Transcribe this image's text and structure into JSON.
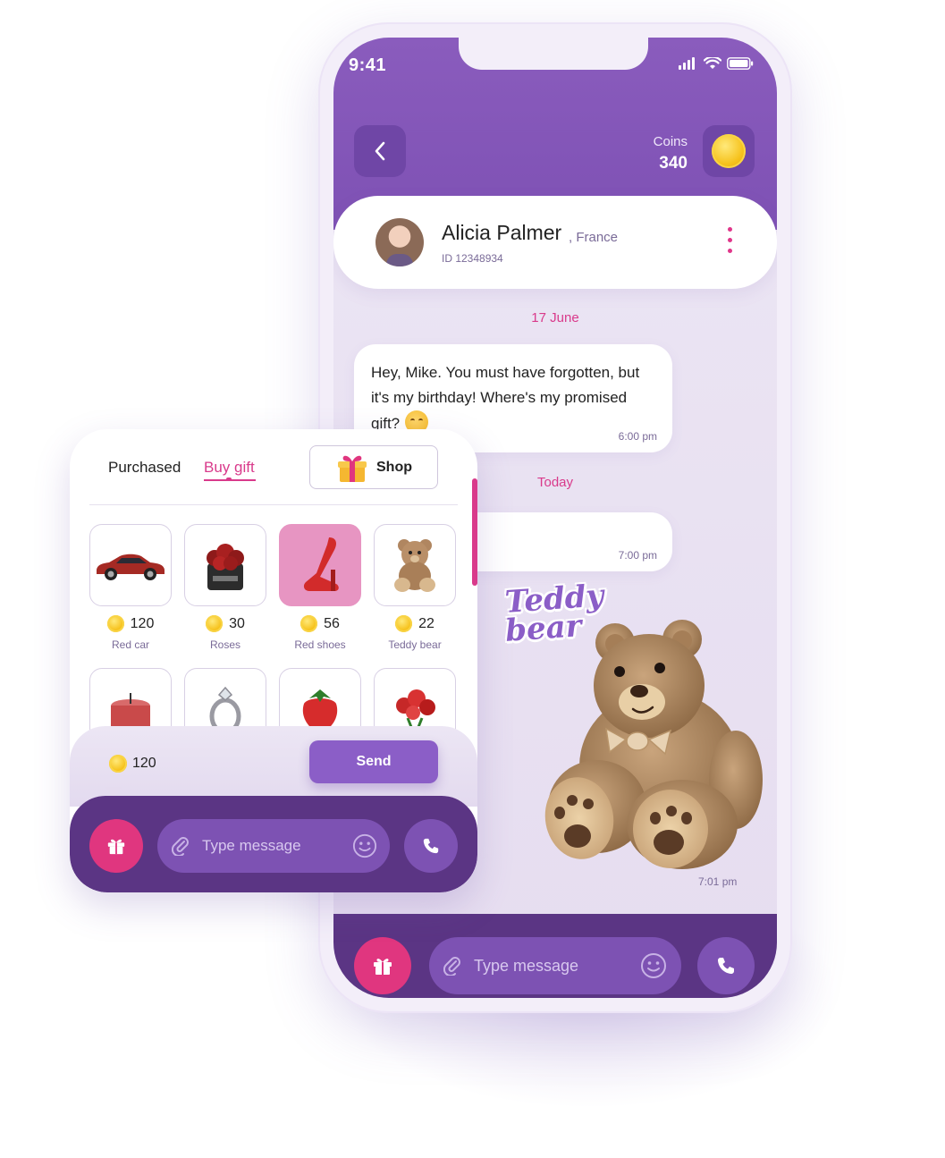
{
  "status_bar": {
    "time": "9:41"
  },
  "header": {
    "coins_label": "Coins",
    "coins_value": "340"
  },
  "profile": {
    "name": "Alicia Palmer",
    "country": ", France",
    "id": "ID 12348934"
  },
  "chat": {
    "date_1": "17 June",
    "message_1": {
      "text": "Hey, Mike. You must have forgotten, but it's my birthday! Where's my promised gift?",
      "time": "6:00 pm"
    },
    "date_2": "Today",
    "message_2": {
      "time": "7:00 pm"
    },
    "sticker": {
      "label_line1": "Teddy",
      "label_line2": "bear",
      "time": "7:01 pm"
    }
  },
  "composer": {
    "placeholder": "Type message"
  },
  "gift_panel": {
    "tabs": {
      "purchased": "Purchased",
      "buy_gift": "Buy gift"
    },
    "shop_label": "Shop",
    "gifts": [
      {
        "name": "Red car",
        "price": "120"
      },
      {
        "name": "Roses",
        "price": "30"
      },
      {
        "name": "Red shoes",
        "price": "56"
      },
      {
        "name": "Teddy bear",
        "price": "22"
      }
    ],
    "total": "120",
    "send_label": "Send",
    "placeholder": "Type message"
  },
  "colors": {
    "primary": "#8a5cbd",
    "accent": "#e0367f",
    "dark": "#5b3584",
    "pink_text": "#d93a8b"
  }
}
